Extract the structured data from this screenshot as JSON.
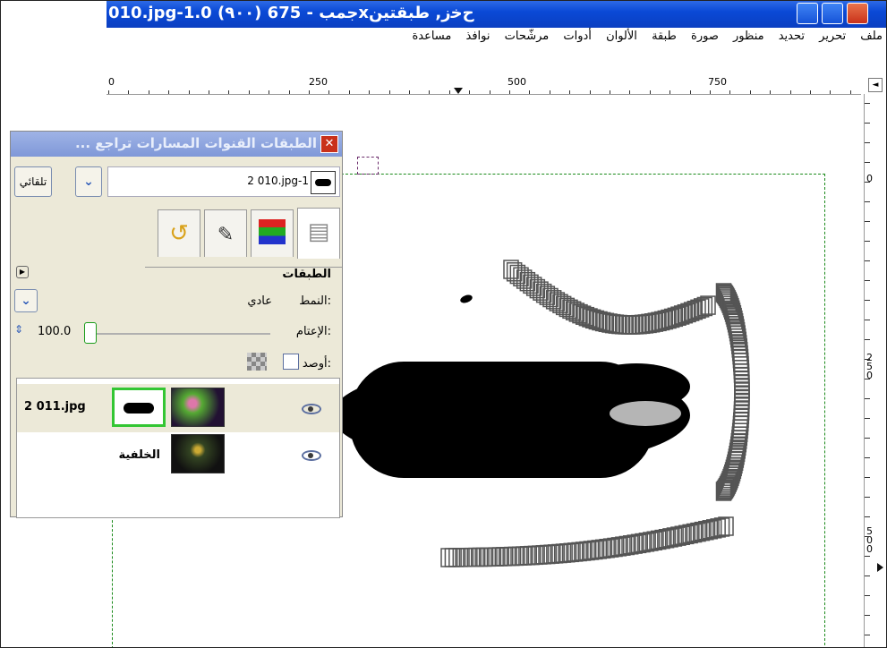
{
  "window": {
    "title": "010.jpg-1.0 (٩٠٠) جمب - 675x‌ﺡﺧﺯ, طبقتين",
    "menu": [
      "ملف",
      "تحرير",
      "تحديد",
      "منظور",
      "صورة",
      "طبقة",
      "الألوان",
      "أدوات",
      "مرشّحات",
      "نوافذ",
      "مساعدة"
    ],
    "ruler_labels": [
      "0",
      "250",
      "500",
      "750"
    ],
    "vruler_labels": [
      "0",
      "2\n5\n0",
      "5\n0\n0"
    ]
  },
  "dock": {
    "title": "الطبقات القنوات المسارات تراجع ...",
    "image_combo": "2 010.jpg-1",
    "auto_button": "تلقائي",
    "section_title": "الطبقات",
    "mode_label": "النمط:",
    "mode_value": "عادي",
    "opacity_label": "الإعتام:",
    "opacity_value": "100.0",
    "lock_label": "أوصد:",
    "layers": [
      {
        "name": "2 011.jpg",
        "selected": true
      },
      {
        "name": "الخلفية",
        "selected": false
      }
    ]
  }
}
